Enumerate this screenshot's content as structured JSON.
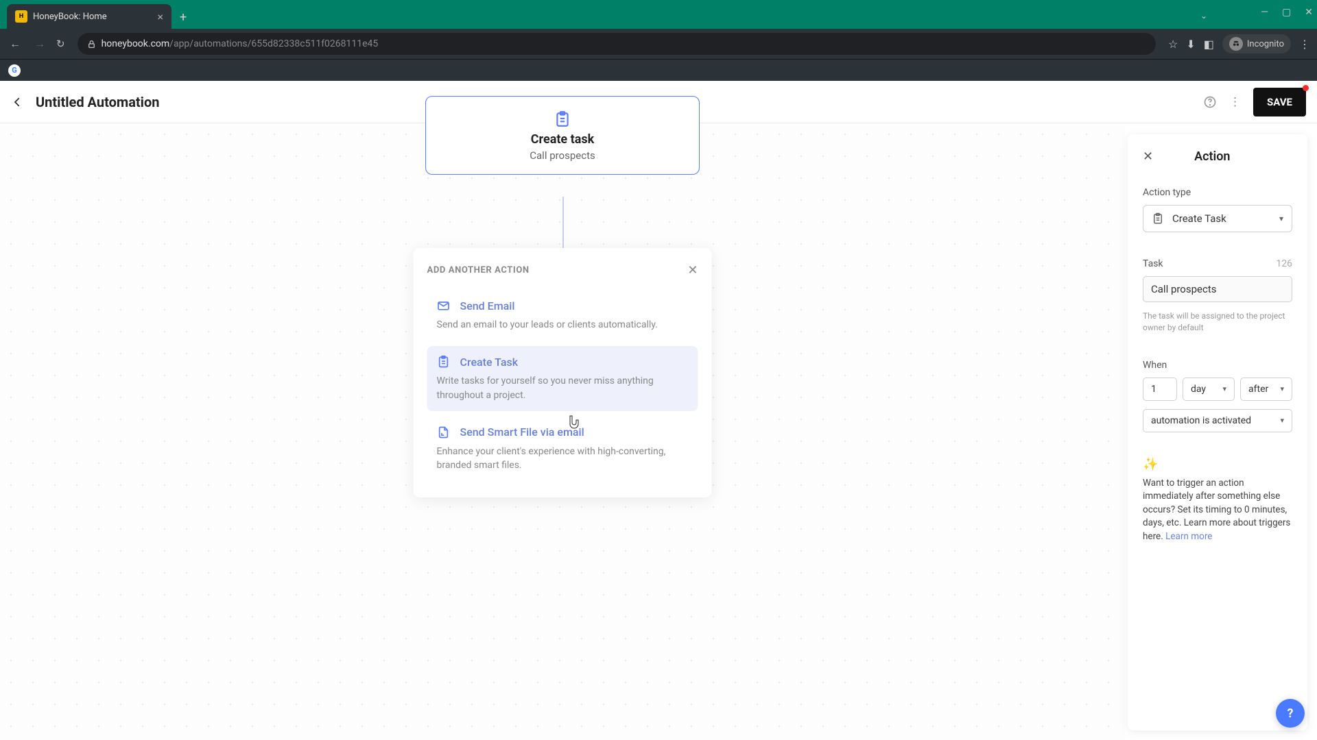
{
  "browser": {
    "tab_title": "HoneyBook: Home",
    "url_domain": "honeybook.com",
    "url_path": "/app/automations/655d82338c511f0268111e45",
    "incognito_label": "Incognito"
  },
  "header": {
    "title": "Untitled Automation",
    "save_label": "SAVE"
  },
  "task_card": {
    "title": "Create task",
    "subtitle": "Call prospects"
  },
  "picker": {
    "title": "ADD ANOTHER ACTION",
    "items": [
      {
        "icon": "mail",
        "title": "Send Email",
        "desc": "Send an email to your leads or clients automatically."
      },
      {
        "icon": "task",
        "title": "Create Task",
        "desc": "Write tasks for yourself so you never miss anything throughout a project."
      },
      {
        "icon": "file",
        "title": "Send Smart File via email",
        "desc": "Enhance your client's experience with high-converting, branded smart files."
      }
    ]
  },
  "sidebar": {
    "title": "Action",
    "action_type_label": "Action type",
    "action_type_value": "Create Task",
    "task_label": "Task",
    "task_counter": "126",
    "task_value": "Call prospects",
    "task_hint": "The task will be assigned to the project owner by default",
    "when_label": "When",
    "when_number": "1",
    "when_unit": "day",
    "when_relation": "after",
    "when_event": "automation is activated",
    "tip_text": "Want to trigger an action immediately after something else occurs? Set its timing to 0 minutes, days, etc. Learn more about triggers here. ",
    "tip_link": "Learn more"
  },
  "help_fab": "?"
}
